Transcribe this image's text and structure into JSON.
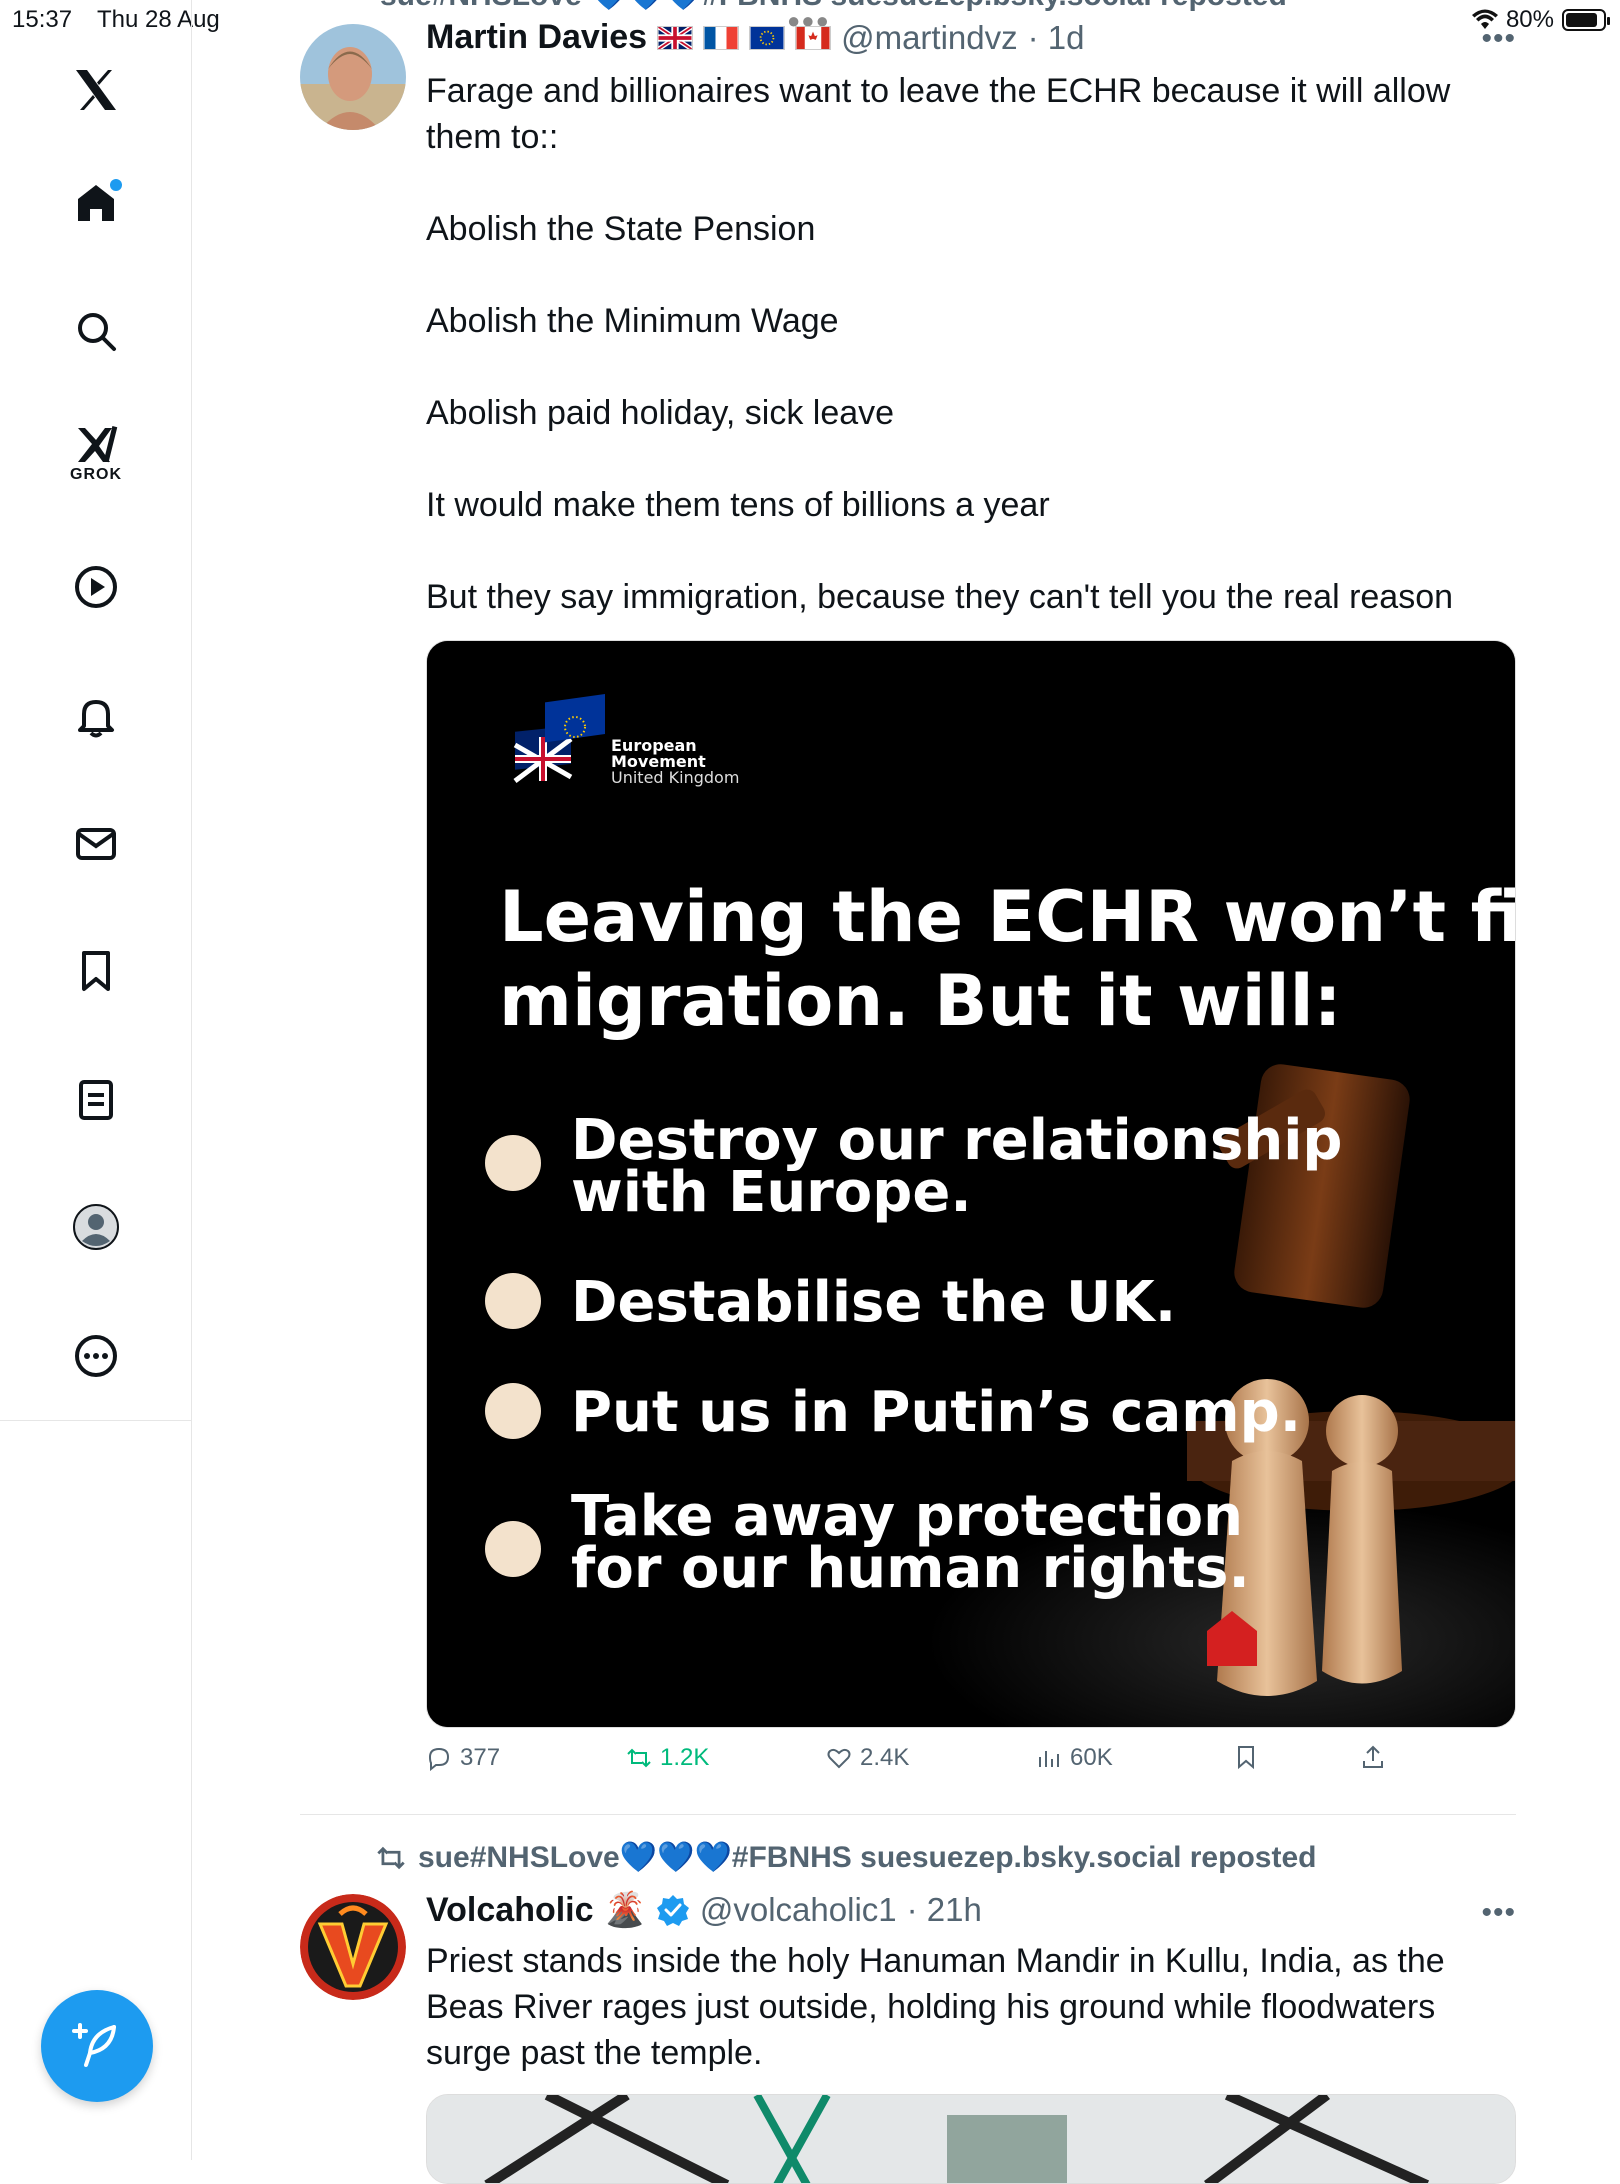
{
  "status_bar": {
    "time": "15:37",
    "date": "Thu 28 Aug",
    "battery": "80%",
    "battery_level": 0.8
  },
  "sidebar": {
    "items": [
      {
        "id": "logo",
        "icon": "x-logo-icon"
      },
      {
        "id": "home",
        "icon": "home-icon",
        "has_notification_dot": true
      },
      {
        "id": "explore",
        "icon": "search-icon"
      },
      {
        "id": "grok",
        "icon": "grok-icon",
        "label": "GROK"
      },
      {
        "id": "videos",
        "icon": "play-icon"
      },
      {
        "id": "notifications",
        "icon": "bell-icon"
      },
      {
        "id": "messages",
        "icon": "mail-icon"
      },
      {
        "id": "bookmarks",
        "icon": "bookmark-icon"
      },
      {
        "id": "lists",
        "icon": "list-icon"
      },
      {
        "id": "profile",
        "icon": "profile-icon"
      },
      {
        "id": "more",
        "icon": "more-circle-icon"
      }
    ],
    "compose_icon": "compose-icon",
    "accent": "#1d9bf0"
  },
  "feed": {
    "top_repost_partial": "sue#NHSLove 💙💙💙#FBNHS suesuezep.bsky.social reposted",
    "posts": [
      {
        "author": "Martin Davies",
        "flags": [
          "UK",
          "France",
          "EU",
          "Canada"
        ],
        "handle": "@martindvz",
        "time": "· 1d",
        "paragraphs": [
          "Farage and billionaires want to leave the ECHR because it will allow them to::",
          "Abolish the State Pension",
          "Abolish the Minimum Wage",
          "Abolish paid holiday, sick leave",
          "It would make them tens of billions a year",
          "But they say immigration, because they can't tell you the real reason"
        ],
        "image": {
          "org_line1": "European",
          "org_line2": "Movement",
          "org_line3": "United Kingdom",
          "headline_line1": "Leaving the ECHR won’t fix",
          "headline_line2": "migration. But it will:",
          "bullets": [
            [
              "Destroy our relationship",
              "with Europe."
            ],
            [
              "Destabilise the UK."
            ],
            [
              "Put us in Putin’s camp."
            ],
            [
              "Take away protection",
              "for our human rights."
            ]
          ]
        },
        "stats": {
          "replies": "377",
          "reposts": "1.2K",
          "likes": "2.4K",
          "views": "60K"
        }
      },
      {
        "repost_by": "sue#NHSLove💙💙💙#FBNHS suesuezep.bsky.social reposted",
        "author": "Volcaholic",
        "author_emoji": "🌋",
        "verified": true,
        "handle": "@volcaholic1",
        "time": "· 21h",
        "paragraphs": [
          "Priest stands inside the holy Hanuman Mandir in Kullu, India, as the Beas River rages just outside, holding his ground while floodwaters surge past the temple."
        ]
      }
    ]
  }
}
